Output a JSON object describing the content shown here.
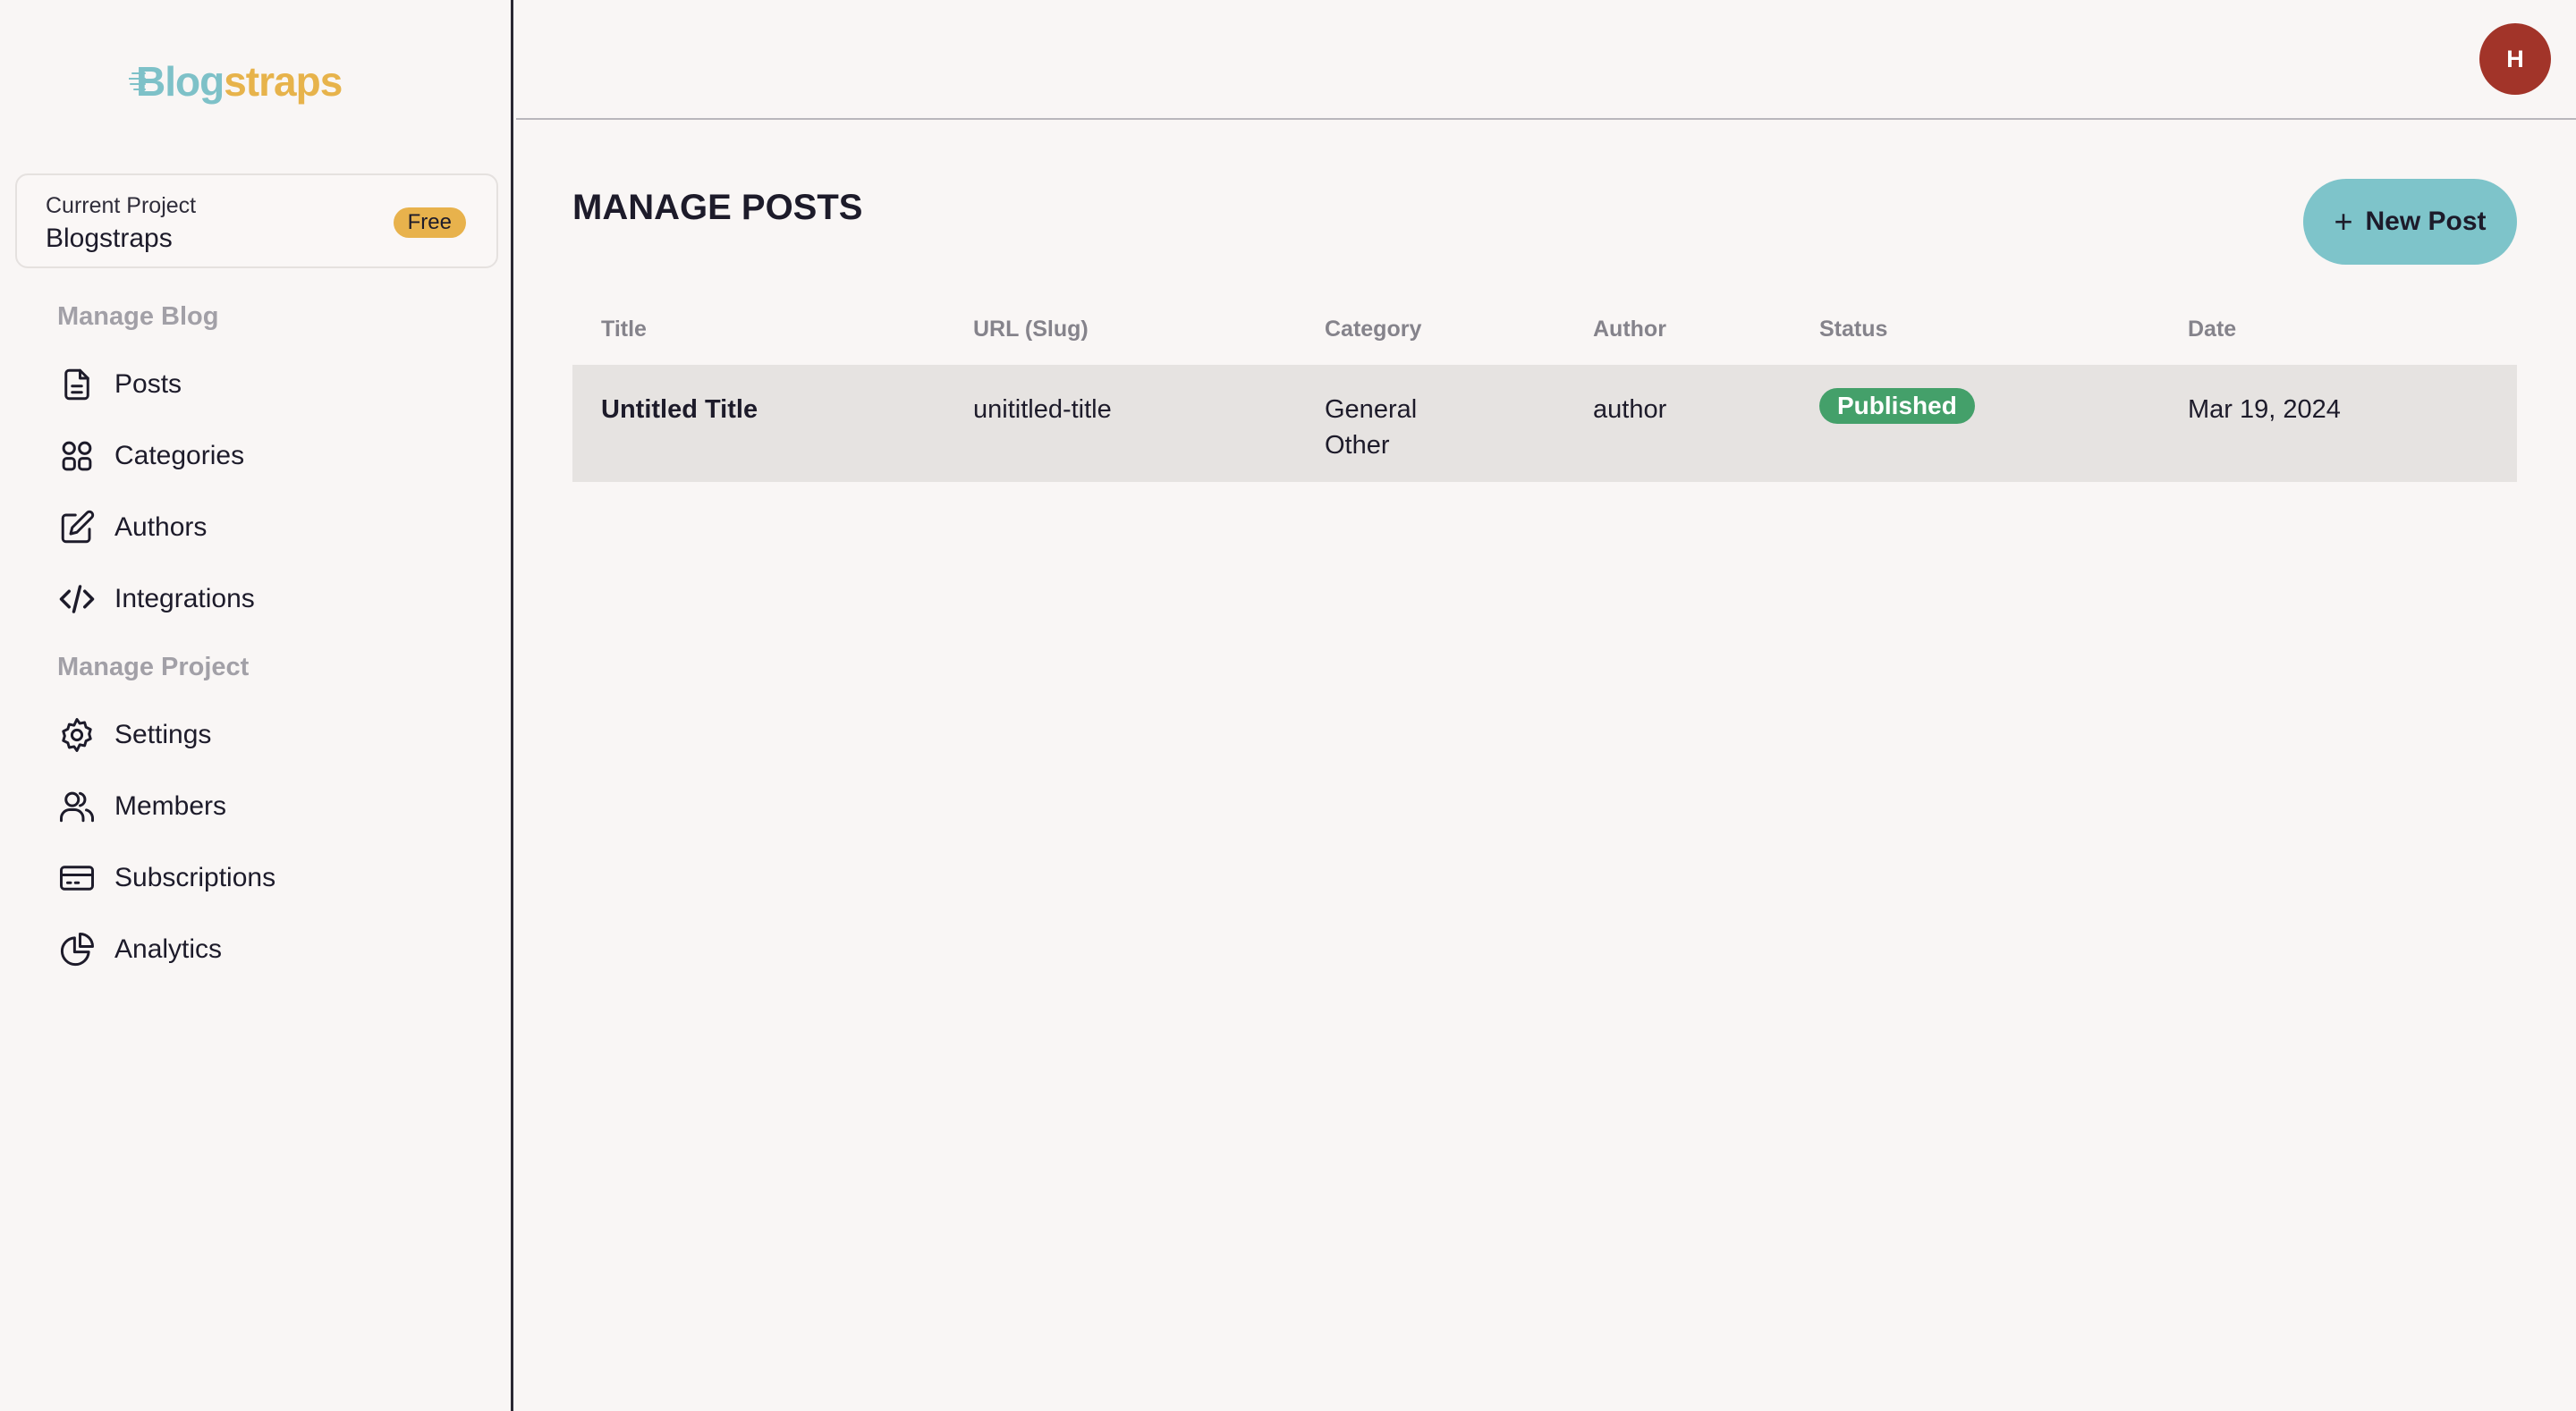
{
  "brand": {
    "logo_part1": "Blog",
    "logo_part2": "straps"
  },
  "project": {
    "caption": "Current Project",
    "name": "Blogstraps",
    "plan_badge": "Free"
  },
  "sidebar": {
    "section_blog": "Manage Blog",
    "blog_items": [
      {
        "label": "Posts",
        "icon": "document-icon"
      },
      {
        "label": "Categories",
        "icon": "grid-icon"
      },
      {
        "label": "Authors",
        "icon": "edit-icon"
      },
      {
        "label": "Integrations",
        "icon": "code-icon"
      }
    ],
    "section_project": "Manage Project",
    "project_items": [
      {
        "label": "Settings",
        "icon": "gear-icon"
      },
      {
        "label": "Members",
        "icon": "users-icon"
      },
      {
        "label": "Subscriptions",
        "icon": "credit-card-icon"
      },
      {
        "label": "Analytics",
        "icon": "pie-chart-icon"
      }
    ]
  },
  "header": {
    "avatar_initial": "H"
  },
  "main": {
    "title": "MANAGE POSTS",
    "new_post_label": "New Post",
    "columns": [
      "Title",
      "URL (Slug)",
      "Category",
      "Author",
      "Status",
      "Date"
    ],
    "rows": [
      {
        "title": "Untitled Title",
        "slug": "unititled-title",
        "categories": [
          "General",
          "Other"
        ],
        "author": "author",
        "status": "Published",
        "date": "Mar 19, 2024"
      }
    ]
  },
  "colors": {
    "accent": "#7ec4ca",
    "brand_yellow": "#e8b24c",
    "status_published": "#44a06a",
    "avatar": "#a23429"
  }
}
